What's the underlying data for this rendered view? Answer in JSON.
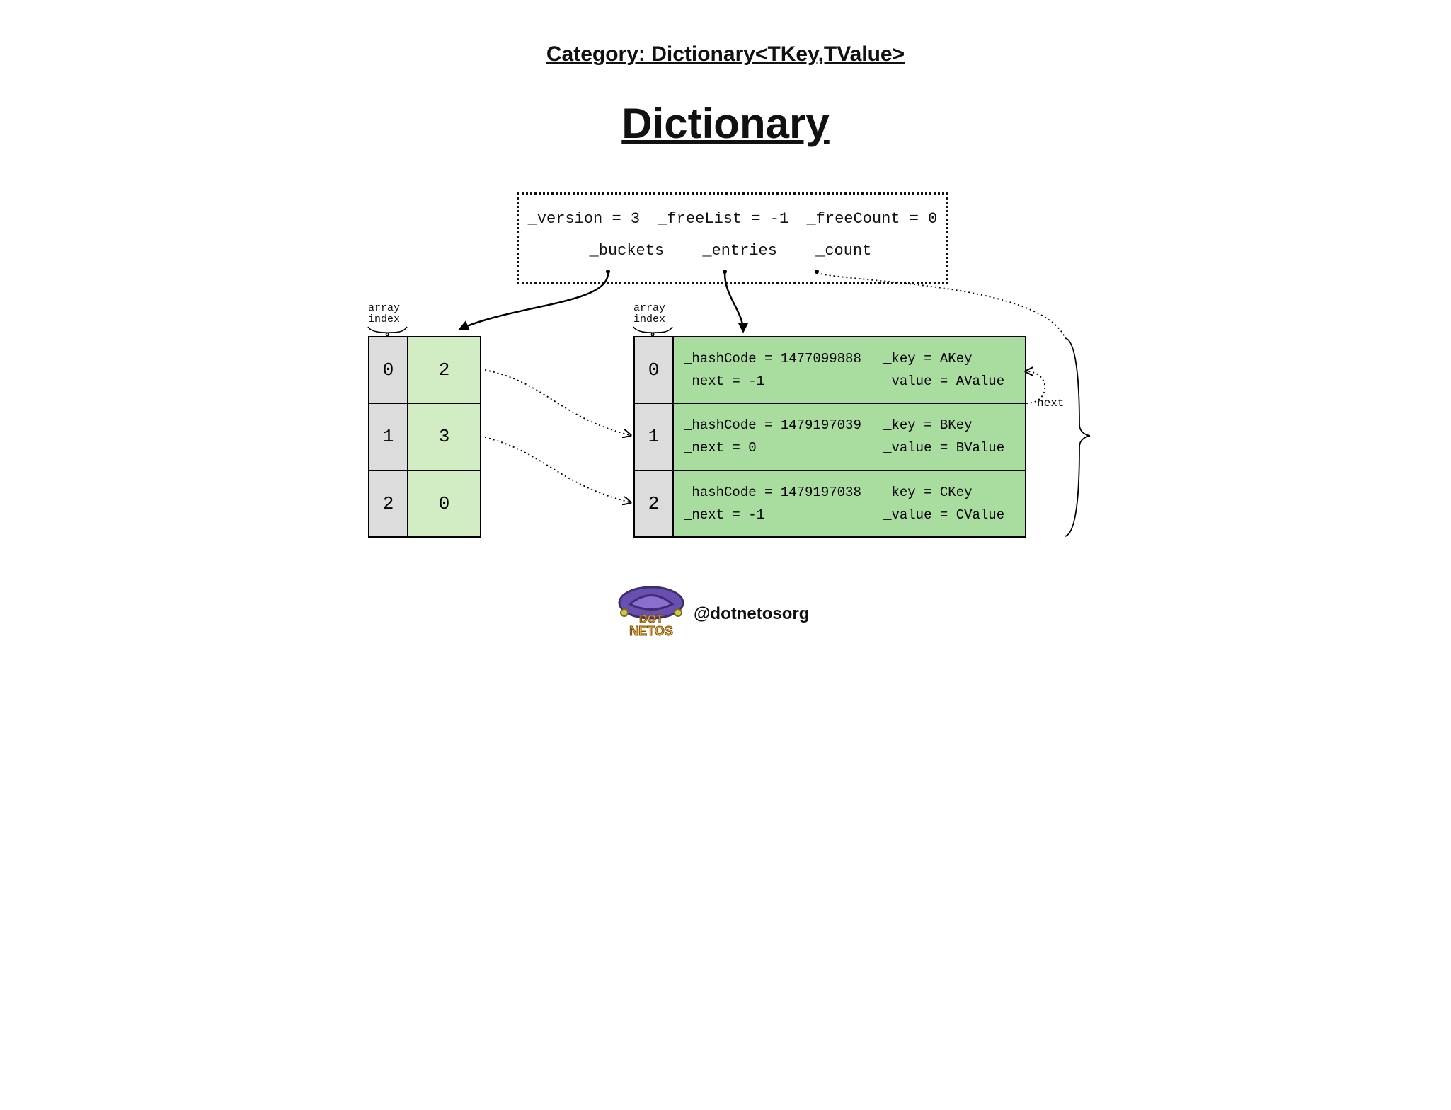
{
  "header": {
    "category": "Category: Dictionary<TKey,TValue>",
    "title": "Dictionary"
  },
  "stateBox": {
    "row1": {
      "version": "_version = 3",
      "freeList": "_freeList = -1",
      "freeCount": "_freeCount = 0"
    },
    "row2": {
      "buckets": "_buckets",
      "entries": "_entries",
      "count": "_count"
    }
  },
  "labels": {
    "arrayIndex": "array\nindex",
    "next": "next"
  },
  "buckets": {
    "rows": [
      {
        "index": "0",
        "value": "2"
      },
      {
        "index": "1",
        "value": "3"
      },
      {
        "index": "2",
        "value": "0"
      }
    ]
  },
  "entries": {
    "rows": [
      {
        "index": "0",
        "hashCode": "_hashCode = 1477099888",
        "next": "_next = -1",
        "key": "_key = AKey",
        "value": "_value = AValue"
      },
      {
        "index": "1",
        "hashCode": "_hashCode = 1479197039",
        "next": "_next = 0",
        "key": "_key = BKey",
        "value": "_value = BValue"
      },
      {
        "index": "2",
        "hashCode": "_hashCode = 1479197038",
        "next": "_next = -1",
        "key": "_key = CKey",
        "value": "_value = CValue"
      }
    ]
  },
  "footer": {
    "handle": "@dotnetosorg",
    "logo_text_top": "DOT",
    "logo_text_bottom": "NETOS"
  }
}
